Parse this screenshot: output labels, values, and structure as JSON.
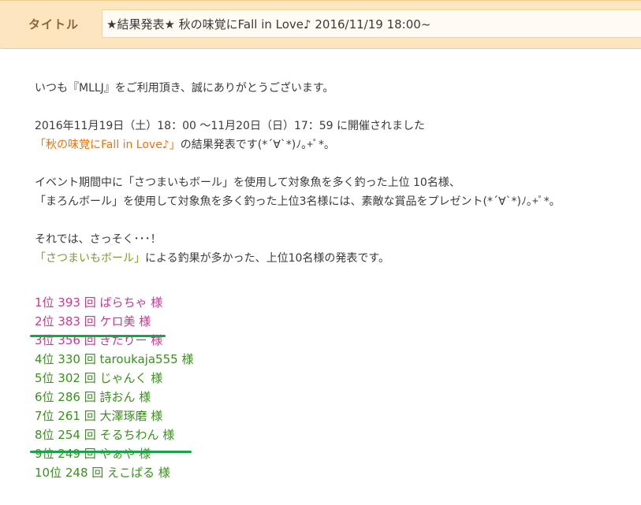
{
  "header": {
    "label": "タイトル",
    "title": "★結果発表★ 秋の味覚にFall in Love♪ 2016/11/19 18:00~"
  },
  "body": {
    "p1": "いつも『MLLJ』をご利用頂き、誠にありがとうございます。",
    "p2_line1": "2016年11月19日（土）18：00 ～11月20日（日）17：59 に開催されました",
    "p2_event": "「秋の味覚にFall in Love♪」",
    "p2_rest": "の結果発表です(*´∀`*)ﾉ｡+ﾟ*｡",
    "p3_line1": "イベント期間中に「さつまいもボール」を使用して対象魚を多く釣った上位 10名様、",
    "p3_line2": "「まろんボール」を使用して対象魚を多く釣った上位3名様には、素敵な賞品をプレゼント(*´∀`*)ﾉ｡+ﾟ*｡",
    "p4_line1": "それでは、さっそく･･･！",
    "p4_ball": "「さつまいもボール」",
    "p4_rest": "による釣果が多かった、上位10名様の発表です。"
  },
  "rankings": [
    "1位 393 回 ばらちゃ 様",
    "2位 383 回 ケロ美 様",
    "3位 356 回 ぎたりー 様",
    "4位 330 回 taroukaja555 様",
    "5位 302 回 じゃんく 様",
    "6位 286 回 詩おん 様",
    "7位 261 回 大澤琢磨 様",
    "8位 254 回 そるちわん 様",
    "9位 249 回 やぁや 様",
    "10位 248 回 えこぱる 様"
  ],
  "colors": {
    "top3": "#c23a92",
    "others": "#3b8f1f",
    "highlight_underline": "#16a34a",
    "event_name": "#e8740c",
    "ball_name": "#7f9a2a"
  }
}
